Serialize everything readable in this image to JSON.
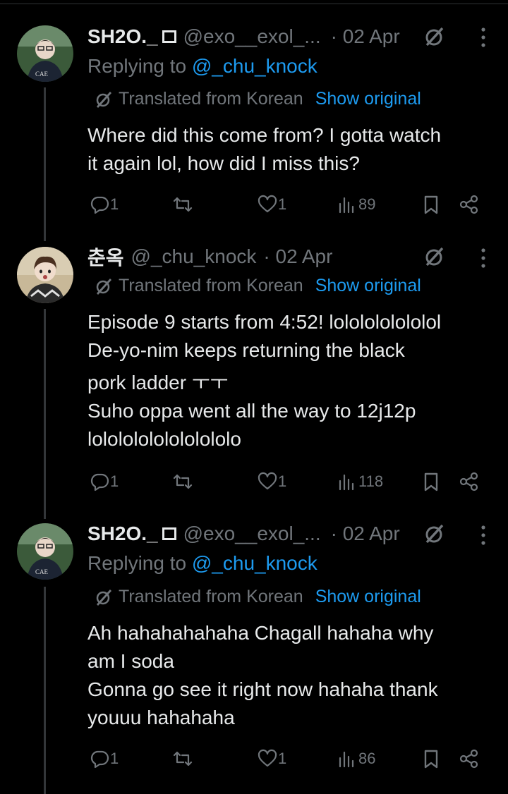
{
  "tweets": [
    {
      "name": "SH2O._",
      "handle": "@exo__exol_...",
      "date": "· 02 Apr",
      "replying_prefix": "Replying to ",
      "replying_to": "@_chu_knock",
      "translated_label": "Translated from Korean",
      "show_original": "Show original",
      "lines": [
        "Where did this come from? I gotta watch",
        "it again lol, how did I miss this?"
      ],
      "replies": "1",
      "retweets": "",
      "likes": "1",
      "views": "89"
    },
    {
      "name": "춘옥",
      "handle": "@_chu_knock",
      "date": "· 02 Apr",
      "translated_label": "Translated from Korean",
      "show_original": "Show original",
      "lines": [
        "Episode 9 starts from 4:52! lololololololol",
        "De-yo-nim keeps returning the black",
        "pork ladder ㅜㅜ",
        "Suho oppa went all the way to 12j12p",
        "lolololololololololo"
      ],
      "replies": "1",
      "retweets": "",
      "likes": "1",
      "views": "118"
    },
    {
      "name": "SH2O._",
      "handle": "@exo__exol_...",
      "date": "· 02 Apr",
      "replying_prefix": "Replying to ",
      "replying_to": "@_chu_knock",
      "translated_label": "Translated from Korean",
      "show_original": "Show original",
      "lines": [
        "Ah hahahahahaha Chagall hahaha why",
        "am I soda",
        "Gonna go see it right now hahaha thank",
        "youuu hahahaha"
      ],
      "replies": "1",
      "retweets": "",
      "likes": "1",
      "views": "86"
    }
  ],
  "colors": {
    "background": "#000000",
    "text": "#e7e9ea",
    "muted": "#71767b",
    "link": "#1d9bf0",
    "divider": "#2f3336"
  },
  "icons": [
    "reply-icon",
    "retweet-icon",
    "like-icon",
    "views-icon",
    "bookmark-icon",
    "share-icon",
    "grok-icon",
    "more-icon",
    "translate-icon"
  ]
}
